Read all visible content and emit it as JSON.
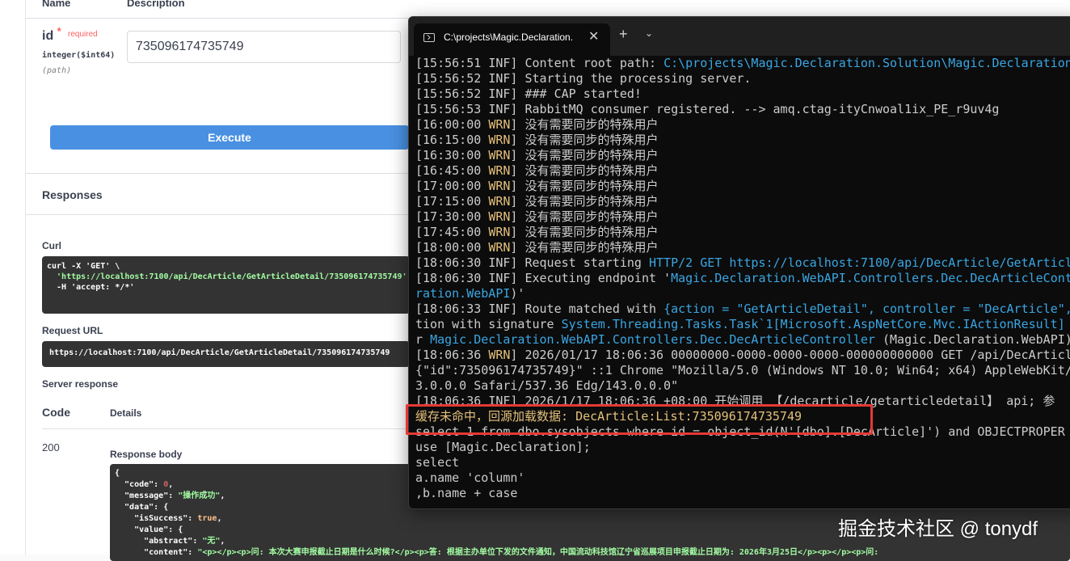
{
  "swagger": {
    "columns": {
      "name": "Name",
      "description": "Description"
    },
    "param": {
      "name": "id",
      "star": "*",
      "required": "required",
      "type": "integer($int64)",
      "location": "(path)",
      "value": "735096174735749"
    },
    "execute_label": "Execute",
    "responses_title": "Responses",
    "curl_label": "Curl",
    "curl_lines": [
      "curl -X 'GET' \\",
      "  'https://localhost:7100/api/DecArticle/GetArticleDetail/735096174735749' \\",
      "  -H 'accept: */*'"
    ],
    "request_url_label": "Request URL",
    "request_url": "https://localhost:7100/api/DecArticle/GetArticleDetail/735096174735749",
    "server_response_label": "Server response",
    "code_header": "Code",
    "details_header": "Details",
    "code_value": "200",
    "response_body_label": "Response body",
    "body": {
      "open": "{",
      "code_key": "  \"code\": ",
      "code_val": "0",
      "message_key": "  \"message\": ",
      "message_val": "\"操作成功\"",
      "data_line": "  \"data\": {",
      "success_key": "    \"isSuccess\": ",
      "success_val": "true",
      "value_line": "    \"value\": {",
      "abstract_key": "      \"abstract\": ",
      "abstract_val": "\"无\"",
      "content_key": "      \"content\": ",
      "content_val": "\"<p></p><p>问: 本次大赛申报截止日期是什么时候?</p><p>答: 根据主办单位下发的文件通知，中国流动科技馆辽宁省巡展项目申报截止日期为: 2026年3月25日</p><p></p><p>问: "
    }
  },
  "terminal": {
    "tab_title": "C:\\projects\\Magic.Declaration.",
    "tab_close": "✕",
    "new_tab": "+",
    "dropdown": "⌄",
    "lines": [
      {
        "pre": "[15:56:51 ",
        "lvl": "INF",
        "mid": "] Content root path: ",
        "hi": "C:\\projects\\Magic.Declaration.Solution\\Magic.Declaration",
        "post": ""
      },
      {
        "pre": "[15:56:52 ",
        "lvl": "INF",
        "mid": "] Starting the processing server.",
        "hi": "",
        "post": ""
      },
      {
        "pre": "[15:56:52 ",
        "lvl": "INF",
        "mid": "] ### CAP started!",
        "hi": "",
        "post": ""
      },
      {
        "pre": "[15:56:53 ",
        "lvl": "INF",
        "mid": "] RabbitMQ consumer registered. --> amq.ctag-ityCnwoal1ix_PE_r9uv4g",
        "hi": "",
        "post": ""
      },
      {
        "pre": "[16:00:00 ",
        "lvl": "WRN",
        "mid": "] 没有需要同步的特殊用户",
        "hi": "",
        "post": ""
      },
      {
        "pre": "[16:15:00 ",
        "lvl": "WRN",
        "mid": "] 没有需要同步的特殊用户",
        "hi": "",
        "post": ""
      },
      {
        "pre": "[16:30:00 ",
        "lvl": "WRN",
        "mid": "] 没有需要同步的特殊用户",
        "hi": "",
        "post": ""
      },
      {
        "pre": "[16:45:00 ",
        "lvl": "WRN",
        "mid": "] 没有需要同步的特殊用户",
        "hi": "",
        "post": ""
      },
      {
        "pre": "[17:00:00 ",
        "lvl": "WRN",
        "mid": "] 没有需要同步的特殊用户",
        "hi": "",
        "post": ""
      },
      {
        "pre": "[17:15:00 ",
        "lvl": "WRN",
        "mid": "] 没有需要同步的特殊用户",
        "hi": "",
        "post": ""
      },
      {
        "pre": "[17:30:00 ",
        "lvl": "WRN",
        "mid": "] 没有需要同步的特殊用户",
        "hi": "",
        "post": ""
      },
      {
        "pre": "[17:45:00 ",
        "lvl": "WRN",
        "mid": "] 没有需要同步的特殊用户",
        "hi": "",
        "post": ""
      },
      {
        "pre": "[18:00:00 ",
        "lvl": "WRN",
        "mid": "] 没有需要同步的特殊用户",
        "hi": "",
        "post": ""
      },
      {
        "pre": "[18:06:30 ",
        "lvl": "INF",
        "mid": "] Request starting ",
        "hi": "HTTP/2 GET https://localhost:7100/api/DecArticle/GetArticl",
        "post": ""
      },
      {
        "pre": "[18:06:30 ",
        "lvl": "INF",
        "mid": "] Executing endpoint '",
        "hi": "Magic.Declaration.WebAPI.Controllers.Dec.DecArticleCont",
        "post": ""
      },
      {
        "pre": "",
        "lvl": "",
        "mid": "",
        "hi": "ration.WebAPI",
        "post": ")'"
      },
      {
        "pre": "[18:06:33 ",
        "lvl": "INF",
        "mid": "] Route matched with ",
        "hi": "{action = \"GetArticleDetail\", controller = \"DecArticle\",",
        "post": ""
      },
      {
        "pre": "",
        "lvl": "",
        "mid": "tion with signature ",
        "hi": "System.Threading.Tasks.Task`1[Microsoft.AspNetCore.Mvc.IActionResult]",
        "post": " G"
      },
      {
        "pre": "",
        "lvl": "",
        "mid": "r ",
        "hi": "Magic.Declaration.WebAPI.Controllers.Dec.DecArticleController",
        "post": " (Magic.Declaration.WebAPI)"
      },
      {
        "pre": "[18:06:36 ",
        "lvl": "WRN",
        "mid": "] 2026/01/17 18:06:36 00000000-0000-0000-0000-000000000000 GET /api/DecArticl",
        "hi": "",
        "post": ""
      },
      {
        "pre": "",
        "lvl": "",
        "mid": "{\"id\":735096174735749}\" ::1 Chrome \"Mozilla/5.0 (Windows NT 10.0; Win64; x64) AppleWebKit/",
        "hi": "",
        "post": ""
      },
      {
        "pre": "",
        "lvl": "",
        "mid": "3.0.0.0 Safari/537.36 Edg/143.0.0.0\"",
        "hi": "",
        "post": ""
      },
      {
        "pre": "[18:06:36 ",
        "lvl": "INF",
        "mid": "] 2026/1/17 18:06:36 +08:00 开始调用 【/decarticle/getarticledetail】 api; 参",
        "hi": "",
        "post": ""
      },
      {
        "pre": "",
        "lvl": "",
        "mid": "",
        "hi": "缓存未命中，回源加载数据: DecArticle:List:735096174735749",
        "post": ""
      },
      {
        "pre": "",
        "lvl": "",
        "mid": "select 1 from dbo.sysobjects where id = object_id(N'[dbo].[DecArticle]') and OBJECTPROPER",
        "hi": "",
        "post": ""
      },
      {
        "pre": "",
        "lvl": "",
        "mid": "use [Magic.Declaration];",
        "hi": "",
        "post": ""
      },
      {
        "pre": "",
        "lvl": "",
        "mid": "select",
        "hi": "",
        "post": ""
      },
      {
        "pre": "",
        "lvl": "",
        "mid": "a.name 'column'",
        "hi": "",
        "post": ""
      },
      {
        "pre": "",
        "lvl": "",
        "mid": ",b.name + case",
        "hi": "",
        "post": ""
      }
    ]
  },
  "watermark": "掘金技术社区 @ tonydf"
}
